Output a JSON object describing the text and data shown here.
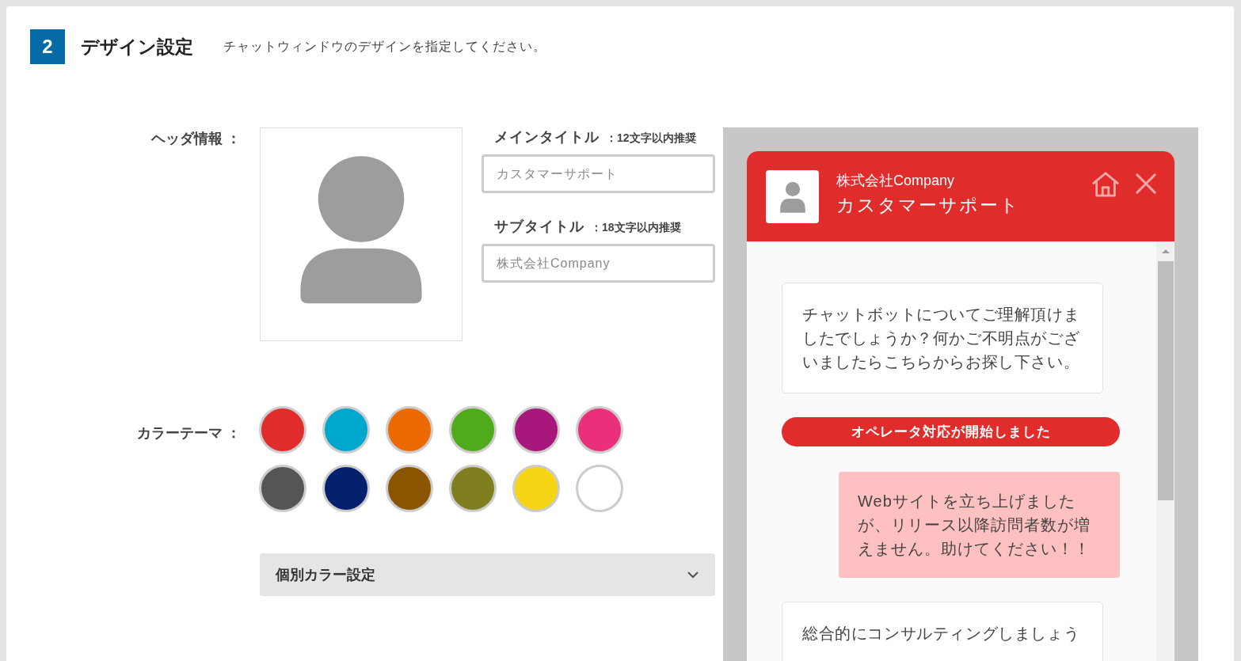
{
  "section": {
    "number": "2",
    "title": "デザイン設定",
    "description": "チャットウィンドウのデザインを指定してください。"
  },
  "header_info": {
    "label": "ヘッダ情報 ：",
    "main_title": {
      "label": "メインタイトル",
      "hint": "：12文字以内推奨",
      "placeholder": "カスタマーサポート"
    },
    "subtitle": {
      "label": "サブタイトル",
      "hint": "：18文字以内推奨",
      "placeholder": "株式会社Company"
    }
  },
  "color_theme": {
    "label": "カラーテーマ ：",
    "swatches": [
      {
        "color": "#e12c2c"
      },
      {
        "color": "#00a7cc"
      },
      {
        "color": "#ed6a02"
      },
      {
        "color": "#4fab1a"
      },
      {
        "color": "#a8177c"
      },
      {
        "color": "#ea2f7b"
      },
      {
        "color": "#555555"
      },
      {
        "color": "#05216e"
      },
      {
        "color": "#8a5400"
      },
      {
        "color": "#807f1f"
      },
      {
        "color": "#f6d614"
      },
      {
        "color": "#ffffff"
      }
    ]
  },
  "custom_colors": {
    "label": "個別カラー設定",
    "expanded": false
  },
  "preview": {
    "subtitle": "株式会社Company",
    "title": "カスタマーサポート",
    "messages": [
      {
        "kind": "bot",
        "text": "チャットボットについてご理解頂けましたでしょうか？何かご不明点がございましたらこちらからお探し下さい。"
      },
      {
        "kind": "notice",
        "text": "オペレータ対応が開始しました"
      },
      {
        "kind": "user",
        "text": "Webサイトを立ち上げましたが、リリース以降訪問者数が増えません。助けてください！！"
      },
      {
        "kind": "bot",
        "text": "総合的にコンサルティングしましょう"
      }
    ]
  }
}
